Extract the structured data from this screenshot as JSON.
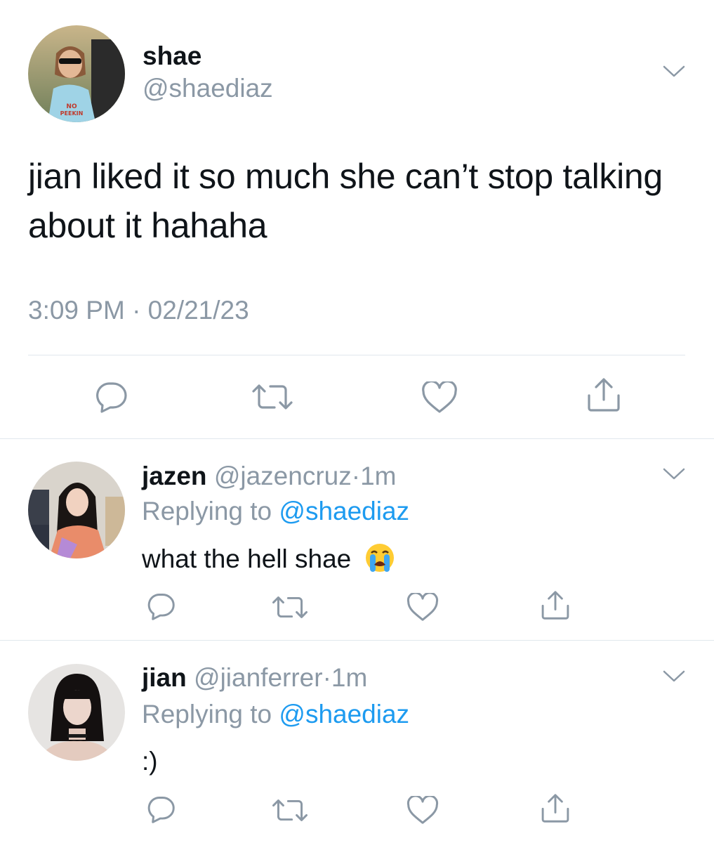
{
  "main_tweet": {
    "display_name": "shae",
    "handle": "@shaediaz",
    "text": "jian liked it so much she can’t stop talking about it hahaha",
    "timestamp": "3:09 PM · 02/21/23",
    "avatar_icon": "user-photo-avatar"
  },
  "replies": [
    {
      "display_name": "jazen",
      "handle": "@jazencruz",
      "separator": "·",
      "age": "1m",
      "replying_label": "Replying to",
      "replying_to": "@shaediaz",
      "text": "what the hell shae",
      "emoji": "loudly-crying-face-emoji"
    },
    {
      "display_name": "jian",
      "handle": "@jianferrer",
      "separator": "·",
      "age": "1m",
      "replying_label": "Replying to",
      "replying_to": "@shaediaz",
      "text": ":)"
    }
  ],
  "actions": [
    "reply-icon",
    "retweet-icon",
    "like-icon",
    "share-icon"
  ],
  "colors": {
    "text": "#0f1419",
    "secondary": "#8b98a5",
    "link": "#1d9bf0",
    "divider": "#e1e8ed"
  }
}
